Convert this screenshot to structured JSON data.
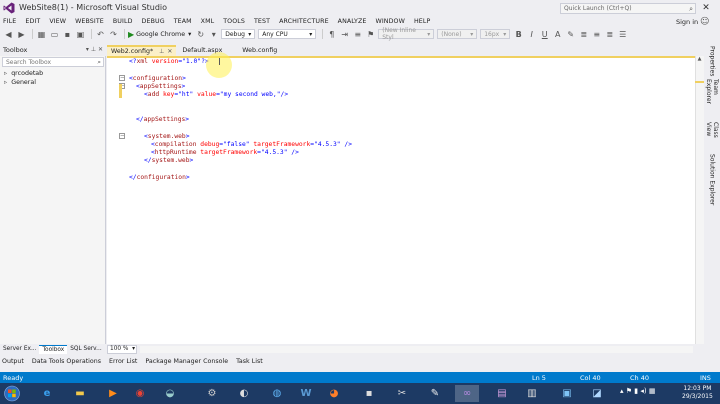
{
  "window": {
    "title": "WebSite8(1) - Microsoft Visual Studio",
    "min": "—",
    "max": "□",
    "close": "✕"
  },
  "menu": [
    "FILE",
    "EDIT",
    "VIEW",
    "WEBSITE",
    "BUILD",
    "DEBUG",
    "TEAM",
    "XML",
    "TOOLS",
    "TEST",
    "ARCHITECTURE",
    "ANALYZE",
    "WINDOW",
    "HELP"
  ],
  "quick_launch": {
    "placeholder": "Quick Launch (Ctrl+Q)"
  },
  "account": {
    "sign_in": "Sign in"
  },
  "toolbar": {
    "browser": "Google Chrome",
    "config": "Debug",
    "platform": "Any CPU",
    "style": "(New Inline Styl",
    "font": "(None)",
    "size": "16px"
  },
  "toolbox": {
    "title": "Toolbox",
    "search_placeholder": "Search Toolbox",
    "nodes": [
      "qrcodetab",
      "General"
    ],
    "bottom_tabs": [
      "Server Ex...",
      "Toolbox",
      "SQL Serv..."
    ]
  },
  "doc_tabs": [
    {
      "label": "Web2.config*",
      "active": true
    },
    {
      "label": "Default.aspx",
      "active": false
    },
    {
      "label": "Web.config",
      "active": false
    }
  ],
  "code": {
    "line1": {
      "br1": "<?",
      "tag": "xml",
      "attr1": " version",
      "eq": "=",
      "val1": "\"1.0\"",
      "br2": "?>"
    },
    "line2": {
      "br1": "<",
      "tag": "configuration",
      "br2": ">"
    },
    "line3": {
      "br1": "<",
      "tag": "appSettings",
      "br2": ">"
    },
    "line4": {
      "br1": "<",
      "tag": "add",
      "attr1": " key",
      "eq1": "=",
      "val1": "\"ht\"",
      "attr2": " value",
      "eq2": "=",
      "val2": "\"my second web,\"",
      "br2": "/>"
    },
    "line5": {
      "br1": "</",
      "tag": "appSettings",
      "br2": ">"
    },
    "line6": {
      "br1": "<",
      "tag": "system.web",
      "br2": ">"
    },
    "line7": {
      "br1": "<",
      "tag": "compilation",
      "attr1": " debug",
      "eq1": "=",
      "val1": "\"false\"",
      "attr2": " targetFramework",
      "eq2": "=",
      "val2": "\"4.5.3\"",
      "br2": " />"
    },
    "line8": {
      "br1": "<",
      "tag": "httpRuntime",
      "attr1": " targetFramework",
      "eq1": "=",
      "val1": "\"4.5.3\"",
      "br2": " />"
    },
    "line9": {
      "br1": "</",
      "tag": "system.web",
      "br2": ">"
    },
    "line10": {
      "br1": "</",
      "tag": "configuration",
      "br2": ">"
    }
  },
  "right_tabs": [
    "Properties",
    "Team Explorer",
    "Class View",
    "Solution Explorer"
  ],
  "zoom": "100 %",
  "output_tabs": [
    "Output",
    "Data Tools Operations",
    "Error List",
    "Package Manager Console",
    "Task List"
  ],
  "status": {
    "ready": "Ready",
    "ln": "Ln 5",
    "col": "Col 40",
    "ch": "Ch 40",
    "ins": "INS"
  },
  "clock": {
    "time": "12:03 PM",
    "date": "29/3/2015"
  },
  "colors": {
    "status_bar": "#007acc",
    "taskbar": "#1d3a64",
    "active_tab": "#fbf0c8",
    "xml_tag": "#a31515",
    "xml_attr": "#ff0000",
    "xml_value": "#0000ff"
  }
}
